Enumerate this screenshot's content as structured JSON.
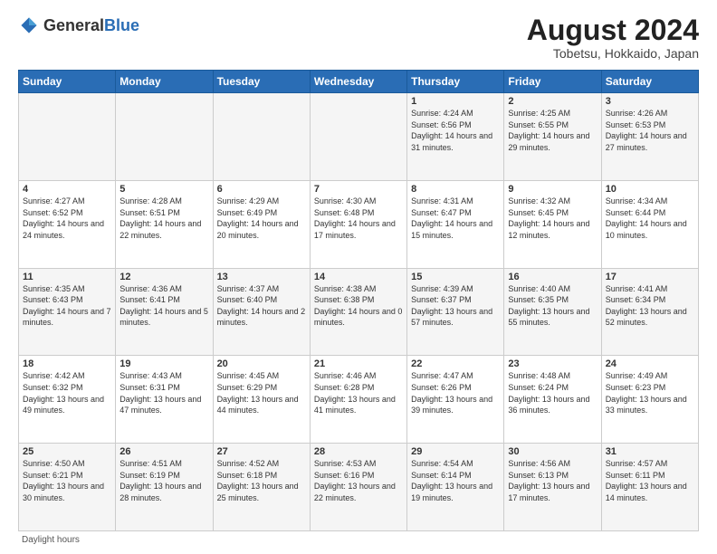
{
  "logo": {
    "general": "General",
    "blue": "Blue"
  },
  "title": "August 2024",
  "subtitle": "Tobetsu, Hokkaido, Japan",
  "weekdays": [
    "Sunday",
    "Monday",
    "Tuesday",
    "Wednesday",
    "Thursday",
    "Friday",
    "Saturday"
  ],
  "footer": "Daylight hours",
  "weeks": [
    [
      {
        "day": "",
        "info": ""
      },
      {
        "day": "",
        "info": ""
      },
      {
        "day": "",
        "info": ""
      },
      {
        "day": "",
        "info": ""
      },
      {
        "day": "1",
        "info": "Sunrise: 4:24 AM\nSunset: 6:56 PM\nDaylight: 14 hours\nand 31 minutes."
      },
      {
        "day": "2",
        "info": "Sunrise: 4:25 AM\nSunset: 6:55 PM\nDaylight: 14 hours\nand 29 minutes."
      },
      {
        "day": "3",
        "info": "Sunrise: 4:26 AM\nSunset: 6:53 PM\nDaylight: 14 hours\nand 27 minutes."
      }
    ],
    [
      {
        "day": "4",
        "info": "Sunrise: 4:27 AM\nSunset: 6:52 PM\nDaylight: 14 hours\nand 24 minutes."
      },
      {
        "day": "5",
        "info": "Sunrise: 4:28 AM\nSunset: 6:51 PM\nDaylight: 14 hours\nand 22 minutes."
      },
      {
        "day": "6",
        "info": "Sunrise: 4:29 AM\nSunset: 6:49 PM\nDaylight: 14 hours\nand 20 minutes."
      },
      {
        "day": "7",
        "info": "Sunrise: 4:30 AM\nSunset: 6:48 PM\nDaylight: 14 hours\nand 17 minutes."
      },
      {
        "day": "8",
        "info": "Sunrise: 4:31 AM\nSunset: 6:47 PM\nDaylight: 14 hours\nand 15 minutes."
      },
      {
        "day": "9",
        "info": "Sunrise: 4:32 AM\nSunset: 6:45 PM\nDaylight: 14 hours\nand 12 minutes."
      },
      {
        "day": "10",
        "info": "Sunrise: 4:34 AM\nSunset: 6:44 PM\nDaylight: 14 hours\nand 10 minutes."
      }
    ],
    [
      {
        "day": "11",
        "info": "Sunrise: 4:35 AM\nSunset: 6:43 PM\nDaylight: 14 hours\nand 7 minutes."
      },
      {
        "day": "12",
        "info": "Sunrise: 4:36 AM\nSunset: 6:41 PM\nDaylight: 14 hours\nand 5 minutes."
      },
      {
        "day": "13",
        "info": "Sunrise: 4:37 AM\nSunset: 6:40 PM\nDaylight: 14 hours\nand 2 minutes."
      },
      {
        "day": "14",
        "info": "Sunrise: 4:38 AM\nSunset: 6:38 PM\nDaylight: 14 hours\nand 0 minutes."
      },
      {
        "day": "15",
        "info": "Sunrise: 4:39 AM\nSunset: 6:37 PM\nDaylight: 13 hours\nand 57 minutes."
      },
      {
        "day": "16",
        "info": "Sunrise: 4:40 AM\nSunset: 6:35 PM\nDaylight: 13 hours\nand 55 minutes."
      },
      {
        "day": "17",
        "info": "Sunrise: 4:41 AM\nSunset: 6:34 PM\nDaylight: 13 hours\nand 52 minutes."
      }
    ],
    [
      {
        "day": "18",
        "info": "Sunrise: 4:42 AM\nSunset: 6:32 PM\nDaylight: 13 hours\nand 49 minutes."
      },
      {
        "day": "19",
        "info": "Sunrise: 4:43 AM\nSunset: 6:31 PM\nDaylight: 13 hours\nand 47 minutes."
      },
      {
        "day": "20",
        "info": "Sunrise: 4:45 AM\nSunset: 6:29 PM\nDaylight: 13 hours\nand 44 minutes."
      },
      {
        "day": "21",
        "info": "Sunrise: 4:46 AM\nSunset: 6:28 PM\nDaylight: 13 hours\nand 41 minutes."
      },
      {
        "day": "22",
        "info": "Sunrise: 4:47 AM\nSunset: 6:26 PM\nDaylight: 13 hours\nand 39 minutes."
      },
      {
        "day": "23",
        "info": "Sunrise: 4:48 AM\nSunset: 6:24 PM\nDaylight: 13 hours\nand 36 minutes."
      },
      {
        "day": "24",
        "info": "Sunrise: 4:49 AM\nSunset: 6:23 PM\nDaylight: 13 hours\nand 33 minutes."
      }
    ],
    [
      {
        "day": "25",
        "info": "Sunrise: 4:50 AM\nSunset: 6:21 PM\nDaylight: 13 hours\nand 30 minutes."
      },
      {
        "day": "26",
        "info": "Sunrise: 4:51 AM\nSunset: 6:19 PM\nDaylight: 13 hours\nand 28 minutes."
      },
      {
        "day": "27",
        "info": "Sunrise: 4:52 AM\nSunset: 6:18 PM\nDaylight: 13 hours\nand 25 minutes."
      },
      {
        "day": "28",
        "info": "Sunrise: 4:53 AM\nSunset: 6:16 PM\nDaylight: 13 hours\nand 22 minutes."
      },
      {
        "day": "29",
        "info": "Sunrise: 4:54 AM\nSunset: 6:14 PM\nDaylight: 13 hours\nand 19 minutes."
      },
      {
        "day": "30",
        "info": "Sunrise: 4:56 AM\nSunset: 6:13 PM\nDaylight: 13 hours\nand 17 minutes."
      },
      {
        "day": "31",
        "info": "Sunrise: 4:57 AM\nSunset: 6:11 PM\nDaylight: 13 hours\nand 14 minutes."
      }
    ]
  ]
}
